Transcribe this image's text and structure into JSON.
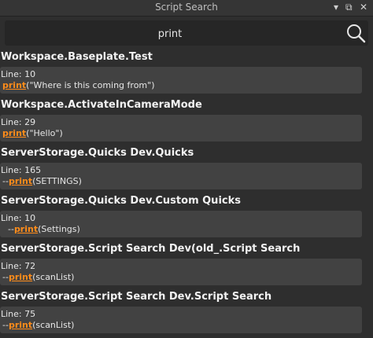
{
  "window": {
    "title": "Script Search",
    "controls": {
      "dropdown": "▾",
      "popout": "⧉",
      "close": "✕"
    }
  },
  "search": {
    "value": "print",
    "placeholder": "",
    "icon": "search-icon"
  },
  "results": [
    {
      "path": "Workspace.Baseplate.Test",
      "line": "Line: 10",
      "prefix": "",
      "keyword": "print",
      "rest": "(\"Where is this coming from\")"
    },
    {
      "path": "Workspace.ActivateInCameraMode",
      "line": "Line: 29",
      "prefix": "",
      "keyword": "print",
      "rest": "(\"Hello\")"
    },
    {
      "path": "ServerStorage.Quicks Dev.Quicks",
      "line": "Line: 165",
      "prefix": "--",
      "keyword": "print",
      "rest": "(SETTINGS)"
    },
    {
      "path": "ServerStorage.Quicks Dev.Custom Quicks",
      "line": "Line: 10",
      "prefix": "  --",
      "keyword": "print",
      "rest": "(Settings)"
    },
    {
      "path": "ServerStorage.Script Search Dev(old_.Script Search",
      "line": "Line: 72",
      "prefix": "--",
      "keyword": "print",
      "rest": "(scanList)"
    },
    {
      "path": "ServerStorage.Script Search Dev.Script Search",
      "line": "Line: 75",
      "prefix": "--",
      "keyword": "print",
      "rest": "(scanList)"
    }
  ],
  "colors": {
    "background": "#2e2e2e",
    "card": "#424242",
    "keyword": "#ff8c1a"
  }
}
